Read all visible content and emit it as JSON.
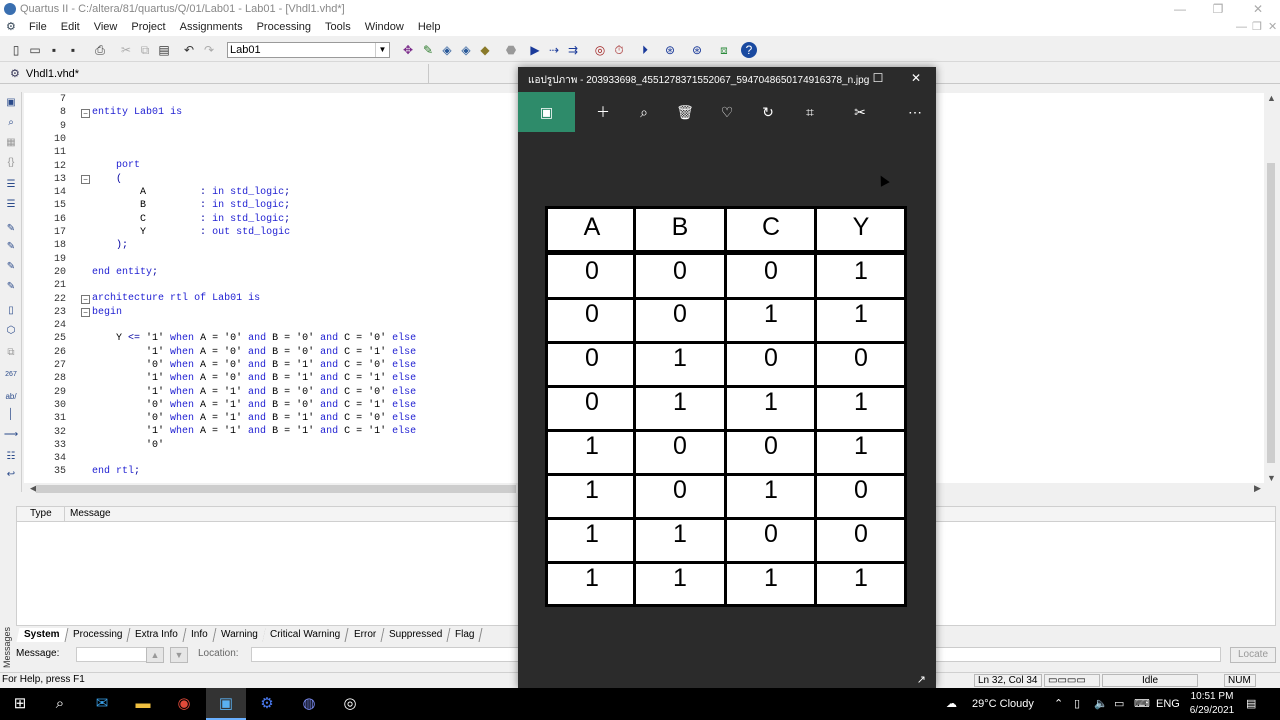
{
  "window": {
    "title": "Quartus II - C:/altera/81/quartus/Q/01/Lab01 - Lab01 - [Vhdl1.vhd*]"
  },
  "menu": [
    "File",
    "Edit",
    "View",
    "Project",
    "Assignments",
    "Processing",
    "Tools",
    "Window",
    "Help"
  ],
  "toolbar": {
    "project_value": "Lab01"
  },
  "editor": {
    "tab_label": "Vhdl1.vhd*",
    "line_numbers": [
      "7",
      "8",
      "9",
      "10",
      "11",
      "12",
      "13",
      "14",
      "15",
      "16",
      "17",
      "18",
      "19",
      "20",
      "21",
      "22",
      "23",
      "24",
      "25",
      "26",
      "27",
      "28",
      "29",
      "30",
      "31",
      "32",
      "33",
      "34",
      "35"
    ]
  },
  "messages": {
    "columns": [
      "Type",
      "Message"
    ],
    "side_label": "Messages",
    "tabs": [
      "System",
      "Processing",
      "Extra Info",
      "Info",
      "Warning",
      "Critical Warning",
      "Error",
      "Suppressed",
      "Flag"
    ],
    "message_label": "Message:",
    "location_label": "Location:",
    "locate_button": "Locate"
  },
  "status": {
    "help_text": "For Help, press F1",
    "position": "Ln 32, Col 34",
    "state": "Idle",
    "num": "NUM"
  },
  "photo": {
    "title": "แอปรูปภาพ - 203933698_4551278371552067_5947048650174916378_n.jpg",
    "truth_table": {
      "headers": [
        "A",
        "B",
        "C",
        "Y"
      ],
      "rows": [
        [
          "0",
          "0",
          "0",
          "1"
        ],
        [
          "0",
          "0",
          "1",
          "1"
        ],
        [
          "0",
          "1",
          "0",
          "0"
        ],
        [
          "0",
          "1",
          "1",
          "1"
        ],
        [
          "1",
          "0",
          "0",
          "1"
        ],
        [
          "1",
          "0",
          "1",
          "0"
        ],
        [
          "1",
          "1",
          "0",
          "0"
        ],
        [
          "1",
          "1",
          "1",
          "1"
        ]
      ]
    }
  },
  "taskbar": {
    "weather": "29°C Cloudy",
    "language": "ENG",
    "time": "10:51 PM",
    "date": "6/29/2021"
  }
}
